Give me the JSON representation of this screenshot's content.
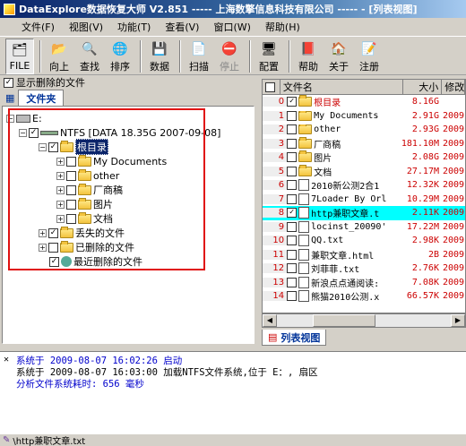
{
  "window": {
    "title": "DataExplore数据恢复大师 V2.851  ----- 上海数擎信息科技有限公司 ----- - [列表视图]"
  },
  "menu": [
    "文件(F)",
    "视图(V)",
    "功能(T)",
    "查看(V)",
    "窗口(W)",
    "帮助(H)"
  ],
  "toolbar": [
    {
      "label": "FILE",
      "icon": "file-icon"
    },
    {
      "label": "向上",
      "icon": "up-icon"
    },
    {
      "label": "查找",
      "icon": "find-icon"
    },
    {
      "label": "排序",
      "icon": "sort-icon"
    },
    {
      "label": "数据",
      "icon": "data-icon"
    },
    {
      "label": "扫描",
      "icon": "scan-icon"
    },
    {
      "label": "停止",
      "icon": "stop-icon"
    },
    {
      "label": "配置",
      "icon": "config-icon"
    },
    {
      "label": "帮助",
      "icon": "help-icon"
    },
    {
      "label": "关于",
      "icon": "about-icon"
    },
    {
      "label": "注册",
      "icon": "register-icon"
    }
  ],
  "left": {
    "show_deleted": "显示删除的文件",
    "tab": "文件夹",
    "tree": {
      "drive": "E:",
      "fs": "NTFS [DATA 18.35G 2007-09-08]",
      "root": "根目录",
      "folders": [
        "My Documents",
        "other",
        "厂商稿",
        "图片",
        "文档"
      ],
      "lost": "丢失的文件",
      "deleted": "已删除的文件",
      "recent": "最近删除的文件"
    }
  },
  "list": {
    "headers": [
      "文件名",
      "大小",
      "修改"
    ],
    "rows": [
      {
        "n": "0",
        "name": "根目录",
        "size": "8.16G",
        "date": "",
        "checked": true,
        "folder": true
      },
      {
        "n": "1",
        "name": "My Documents",
        "size": "2.91G",
        "date": "2009-",
        "checked": false,
        "folder": true
      },
      {
        "n": "2",
        "name": "other",
        "size": "2.93G",
        "date": "2009-",
        "checked": false,
        "folder": true
      },
      {
        "n": "3",
        "name": "厂商稿",
        "size": "181.10M",
        "date": "2009-",
        "checked": false,
        "folder": true
      },
      {
        "n": "4",
        "name": "图片",
        "size": "2.08G",
        "date": "2009-",
        "checked": false,
        "folder": true
      },
      {
        "n": "5",
        "name": "文档",
        "size": "27.17M",
        "date": "2009-",
        "checked": false,
        "folder": true
      },
      {
        "n": "6",
        "name": "2010新公测2合1",
        "size": "12.32K",
        "date": "2009-",
        "checked": false,
        "folder": false
      },
      {
        "n": "7",
        "name": "7Loader By Orl",
        "size": "10.29M",
        "date": "2009-",
        "checked": false,
        "folder": false
      },
      {
        "n": "8",
        "name": "http兼职文章.t",
        "size": "2.11K",
        "date": "2009-",
        "checked": true,
        "folder": false,
        "hl": true
      },
      {
        "n": "9",
        "name": "locinst_20090'",
        "size": "17.22M",
        "date": "2009-",
        "checked": false,
        "folder": false
      },
      {
        "n": "10",
        "name": "QQ.txt",
        "size": "2.98K",
        "date": "2009-",
        "checked": false,
        "folder": false
      },
      {
        "n": "11",
        "name": "兼职文章.html",
        "size": "2B",
        "date": "2009-",
        "checked": false,
        "folder": false
      },
      {
        "n": "12",
        "name": "刘菲菲.txt",
        "size": "2.76K",
        "date": "2009-",
        "checked": false,
        "folder": false
      },
      {
        "n": "13",
        "name": "新浪点点通阅读:",
        "size": "7.08K",
        "date": "2009-",
        "checked": false,
        "folder": false
      },
      {
        "n": "14",
        "name": "熊猫2010公测.x",
        "size": "66.57K",
        "date": "2009-",
        "checked": false,
        "folder": false
      }
    ],
    "bottom_tab": "列表视图"
  },
  "log": [
    {
      "text": "系统于 2009-08-07 16:02:26 启动",
      "color": "#0000cc"
    },
    {
      "text": "系统于 2009-08-07 16:03:00 加载NTFS文件系统,位于 E：,  扇区",
      "color": "#000000"
    },
    {
      "text": "分析文件系统耗时: 656 毫秒",
      "color": "#0000cc"
    }
  ],
  "status": {
    "text": "\\http兼职文章.txt"
  }
}
